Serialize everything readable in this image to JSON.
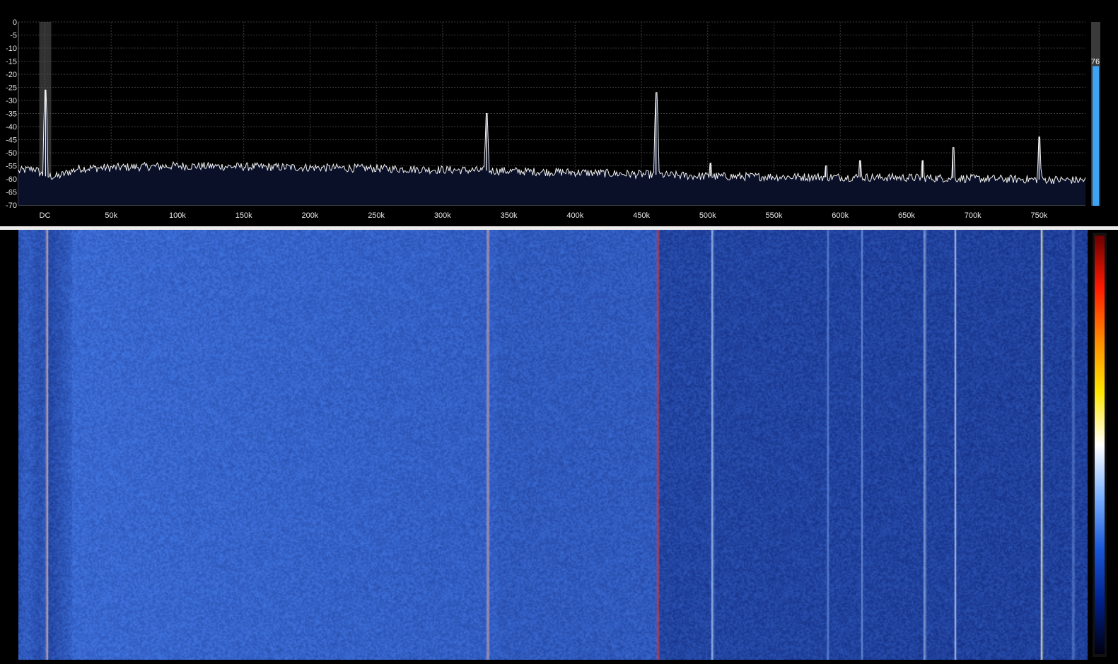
{
  "spectrum": {
    "y_ticks": [
      "0",
      "-5",
      "-10",
      "-15",
      "-20",
      "-25",
      "-30",
      "-35",
      "-40",
      "-45",
      "-50",
      "-55",
      "-60",
      "-65",
      "-70"
    ],
    "y_range_db": [
      -70,
      0
    ],
    "x_ticks": [
      {
        "label": "DC",
        "khz": 0
      },
      {
        "label": "50k",
        "khz": 50
      },
      {
        "label": "100k",
        "khz": 100
      },
      {
        "label": "150k",
        "khz": 150
      },
      {
        "label": "200k",
        "khz": 200
      },
      {
        "label": "250k",
        "khz": 250
      },
      {
        "label": "300k",
        "khz": 300
      },
      {
        "label": "350k",
        "khz": 350
      },
      {
        "label": "400k",
        "khz": 400
      },
      {
        "label": "450k",
        "khz": 450
      },
      {
        "label": "500k",
        "khz": 500
      },
      {
        "label": "550k",
        "khz": 550
      },
      {
        "label": "600k",
        "khz": 600
      },
      {
        "label": "650k",
        "khz": 650
      },
      {
        "label": "700k",
        "khz": 700
      },
      {
        "label": "750k",
        "khz": 750
      }
    ],
    "x_range_khz": [
      -20,
      785
    ],
    "peaks": [
      {
        "khz": 0.5,
        "db": -26
      },
      {
        "khz": 333,
        "db": -35
      },
      {
        "khz": 461,
        "db": -27
      },
      {
        "khz": 502,
        "db": -54
      },
      {
        "khz": 589,
        "db": -55
      },
      {
        "khz": 615,
        "db": -53
      },
      {
        "khz": 662,
        "db": -53
      },
      {
        "khz": 685,
        "db": -48
      },
      {
        "khz": 750,
        "db": -44
      }
    ],
    "noise_floor_db": [
      {
        "khz": -20,
        "db": -57
      },
      {
        "khz": -8,
        "db": -56
      },
      {
        "khz": 0,
        "db": -59
      },
      {
        "khz": 10,
        "db": -59
      },
      {
        "khz": 25,
        "db": -56
      },
      {
        "khz": 100,
        "db": -55
      },
      {
        "khz": 250,
        "db": -56
      },
      {
        "khz": 400,
        "db": -57.5
      },
      {
        "khz": 500,
        "db": -59
      },
      {
        "khz": 650,
        "db": -59.5
      },
      {
        "khz": 785,
        "db": -60.5
      }
    ],
    "gain_value": "76",
    "gain_level_percent": 76,
    "colors": {
      "background": "#000000",
      "fill": "#0a1028",
      "trace": "#f2f2f2",
      "grid": "#3c3c3c",
      "vfo_band": "#5a5a5a",
      "vfo_line": "#ff3030",
      "gain_bar": "#3fa2f2",
      "gain_track": "#3a3a3a"
    }
  },
  "waterfall": {
    "palette": [
      "#000010",
      "#00208a",
      "#1a56d8",
      "#7ab0ff",
      "#ffffff",
      "#ffe600",
      "#ff8a00",
      "#ff1a00",
      "#6a0000"
    ],
    "vfo_line_color": "#e03a3a"
  }
}
